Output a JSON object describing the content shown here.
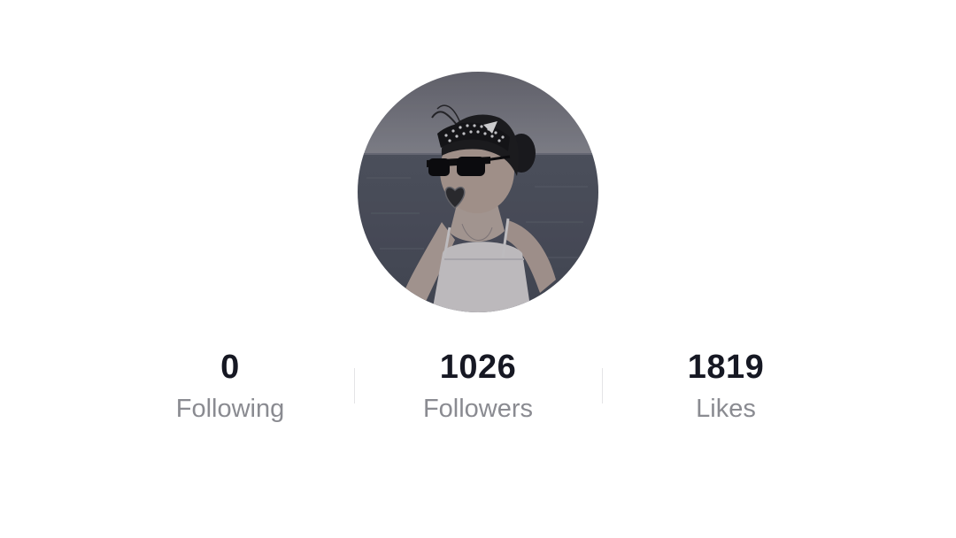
{
  "profile": {
    "avatar_icon": "profile-photo",
    "stats": [
      {
        "count": "0",
        "label": "Following"
      },
      {
        "count": "1026",
        "label": "Followers"
      },
      {
        "count": "1819",
        "label": "Likes"
      }
    ]
  },
  "colors": {
    "count_text": "#161823",
    "label_text": "#8a8b91",
    "divider": "#e4e4e6"
  }
}
